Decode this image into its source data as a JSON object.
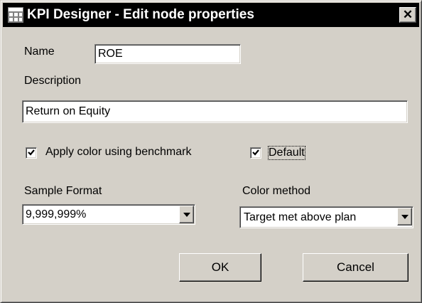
{
  "window": {
    "title": "KPI Designer - Edit node properties",
    "close_glyph": "✕",
    "icon": "kpi-designer-app-icon"
  },
  "form": {
    "name_label": "Name",
    "name_value": "ROE",
    "description_label": "Description",
    "description_value": "Return on Equity",
    "apply_color_label": "Apply color using benchmark",
    "apply_color_checked": true,
    "default_label": "Default",
    "default_checked": true,
    "sample_format_label": "Sample Format",
    "sample_format_value": "9,999,999%",
    "color_method_label": "Color method",
    "color_method_value": "Target met above plan"
  },
  "buttons": {
    "ok": "OK",
    "cancel": "Cancel"
  },
  "colors": {
    "face": "#d4d0c8",
    "titlebar": "#000000",
    "title_text": "#ffffff"
  }
}
